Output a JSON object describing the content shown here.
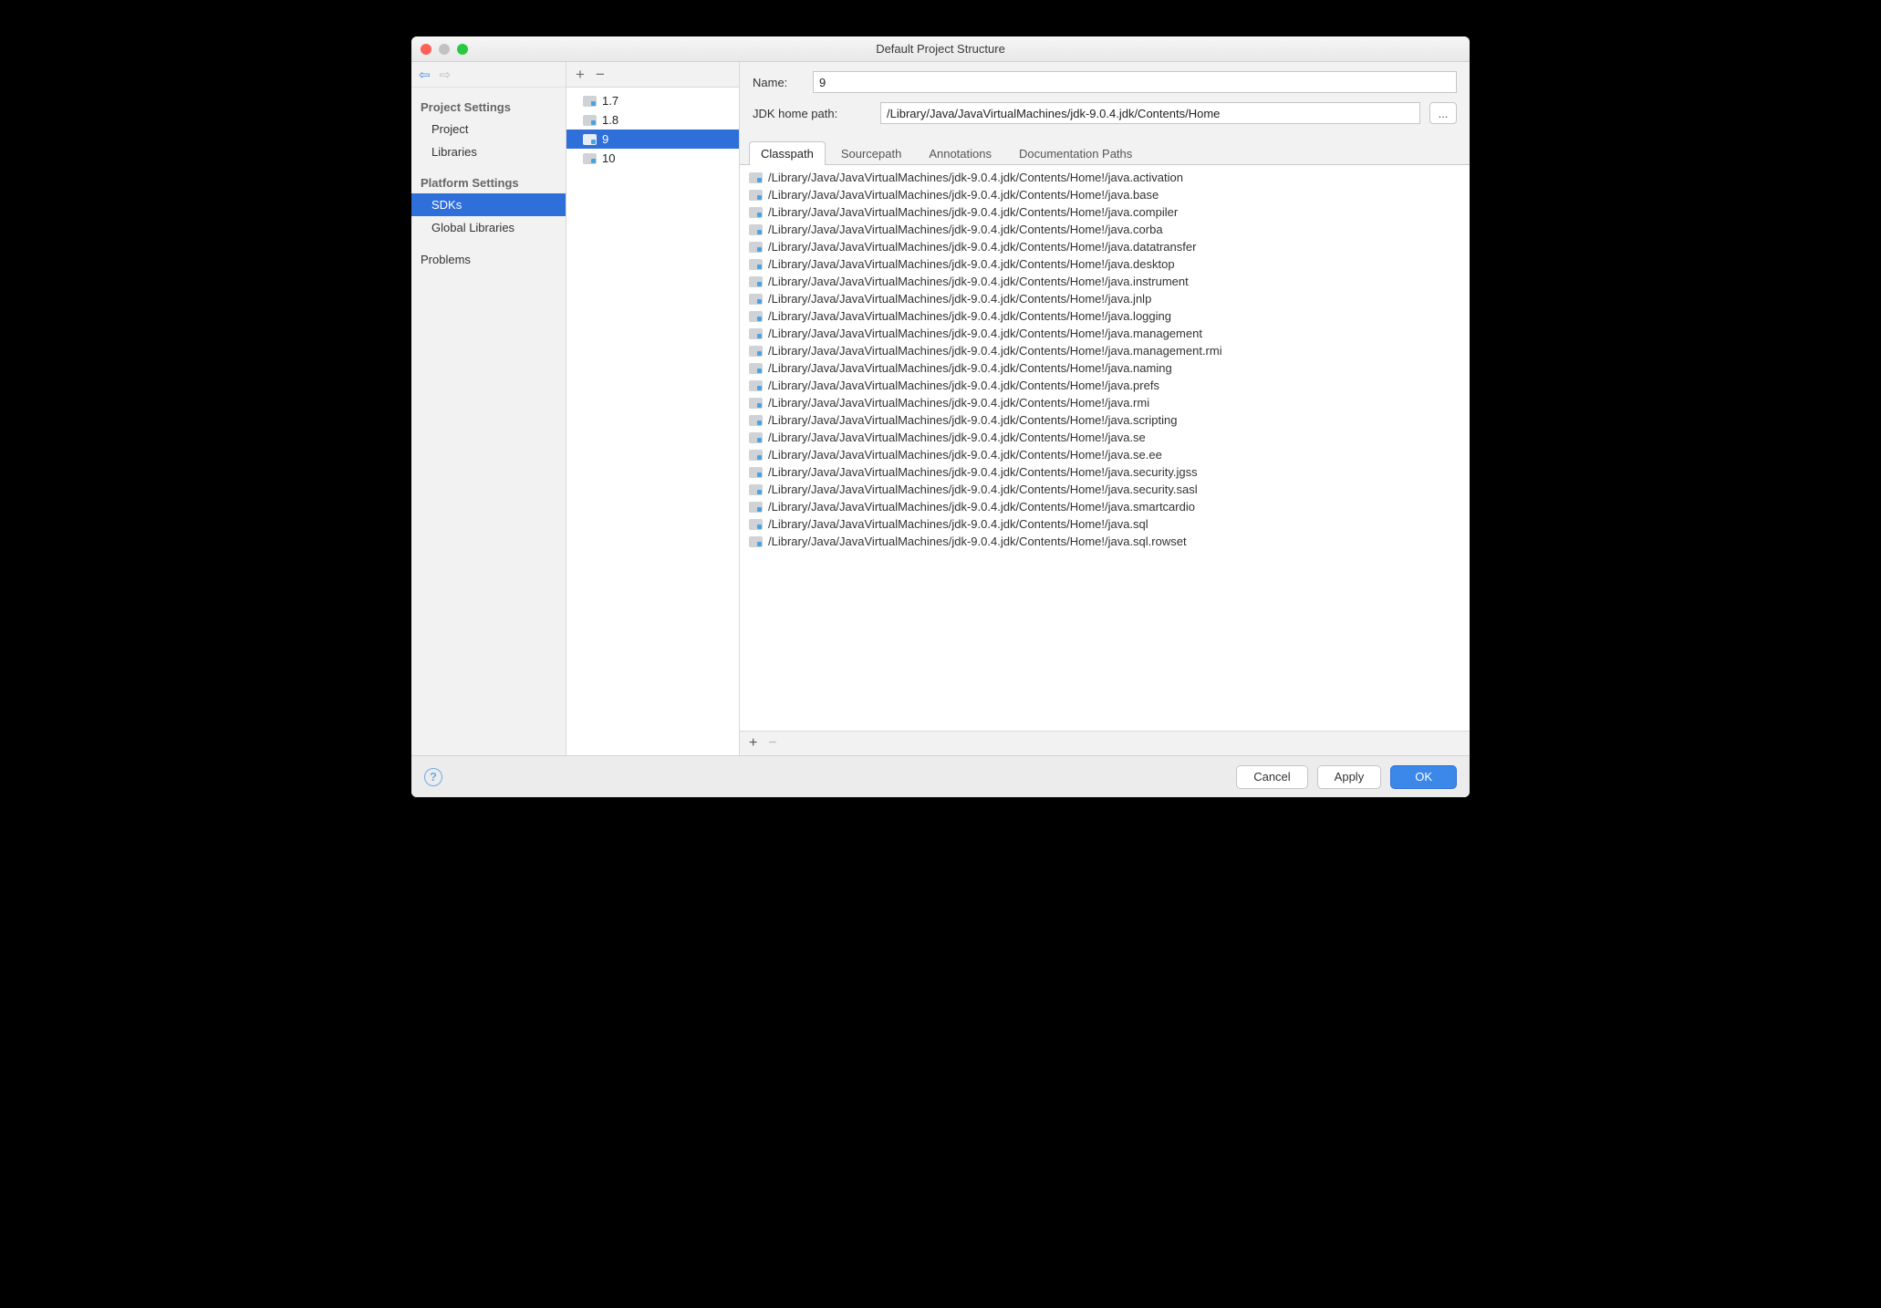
{
  "window": {
    "title": "Default Project Structure"
  },
  "nav": {
    "section1": "Project Settings",
    "item_project": "Project",
    "item_libraries": "Libraries",
    "section2": "Platform Settings",
    "item_sdks": "SDKs",
    "item_global": "Global Libraries",
    "item_problems": "Problems"
  },
  "sdks": {
    "items": [
      {
        "label": "1.7"
      },
      {
        "label": "1.8"
      },
      {
        "label": "9"
      },
      {
        "label": "10"
      }
    ]
  },
  "fields": {
    "name_label": "Name:",
    "name_value": "9",
    "home_label": "JDK home path:",
    "home_value": "/Library/Java/JavaVirtualMachines/jdk-9.0.4.jdk/Contents/Home",
    "browse": "..."
  },
  "tabs": {
    "t0": "Classpath",
    "t1": "Sourcepath",
    "t2": "Annotations",
    "t3": "Documentation Paths"
  },
  "classpath": [
    "/Library/Java/JavaVirtualMachines/jdk-9.0.4.jdk/Contents/Home!/java.activation",
    "/Library/Java/JavaVirtualMachines/jdk-9.0.4.jdk/Contents/Home!/java.base",
    "/Library/Java/JavaVirtualMachines/jdk-9.0.4.jdk/Contents/Home!/java.compiler",
    "/Library/Java/JavaVirtualMachines/jdk-9.0.4.jdk/Contents/Home!/java.corba",
    "/Library/Java/JavaVirtualMachines/jdk-9.0.4.jdk/Contents/Home!/java.datatransfer",
    "/Library/Java/JavaVirtualMachines/jdk-9.0.4.jdk/Contents/Home!/java.desktop",
    "/Library/Java/JavaVirtualMachines/jdk-9.0.4.jdk/Contents/Home!/java.instrument",
    "/Library/Java/JavaVirtualMachines/jdk-9.0.4.jdk/Contents/Home!/java.jnlp",
    "/Library/Java/JavaVirtualMachines/jdk-9.0.4.jdk/Contents/Home!/java.logging",
    "/Library/Java/JavaVirtualMachines/jdk-9.0.4.jdk/Contents/Home!/java.management",
    "/Library/Java/JavaVirtualMachines/jdk-9.0.4.jdk/Contents/Home!/java.management.rmi",
    "/Library/Java/JavaVirtualMachines/jdk-9.0.4.jdk/Contents/Home!/java.naming",
    "/Library/Java/JavaVirtualMachines/jdk-9.0.4.jdk/Contents/Home!/java.prefs",
    "/Library/Java/JavaVirtualMachines/jdk-9.0.4.jdk/Contents/Home!/java.rmi",
    "/Library/Java/JavaVirtualMachines/jdk-9.0.4.jdk/Contents/Home!/java.scripting",
    "/Library/Java/JavaVirtualMachines/jdk-9.0.4.jdk/Contents/Home!/java.se",
    "/Library/Java/JavaVirtualMachines/jdk-9.0.4.jdk/Contents/Home!/java.se.ee",
    "/Library/Java/JavaVirtualMachines/jdk-9.0.4.jdk/Contents/Home!/java.security.jgss",
    "/Library/Java/JavaVirtualMachines/jdk-9.0.4.jdk/Contents/Home!/java.security.sasl",
    "/Library/Java/JavaVirtualMachines/jdk-9.0.4.jdk/Contents/Home!/java.smartcardio",
    "/Library/Java/JavaVirtualMachines/jdk-9.0.4.jdk/Contents/Home!/java.sql",
    "/Library/Java/JavaVirtualMachines/jdk-9.0.4.jdk/Contents/Home!/java.sql.rowset"
  ],
  "footer": {
    "cancel": "Cancel",
    "apply": "Apply",
    "ok": "OK"
  }
}
